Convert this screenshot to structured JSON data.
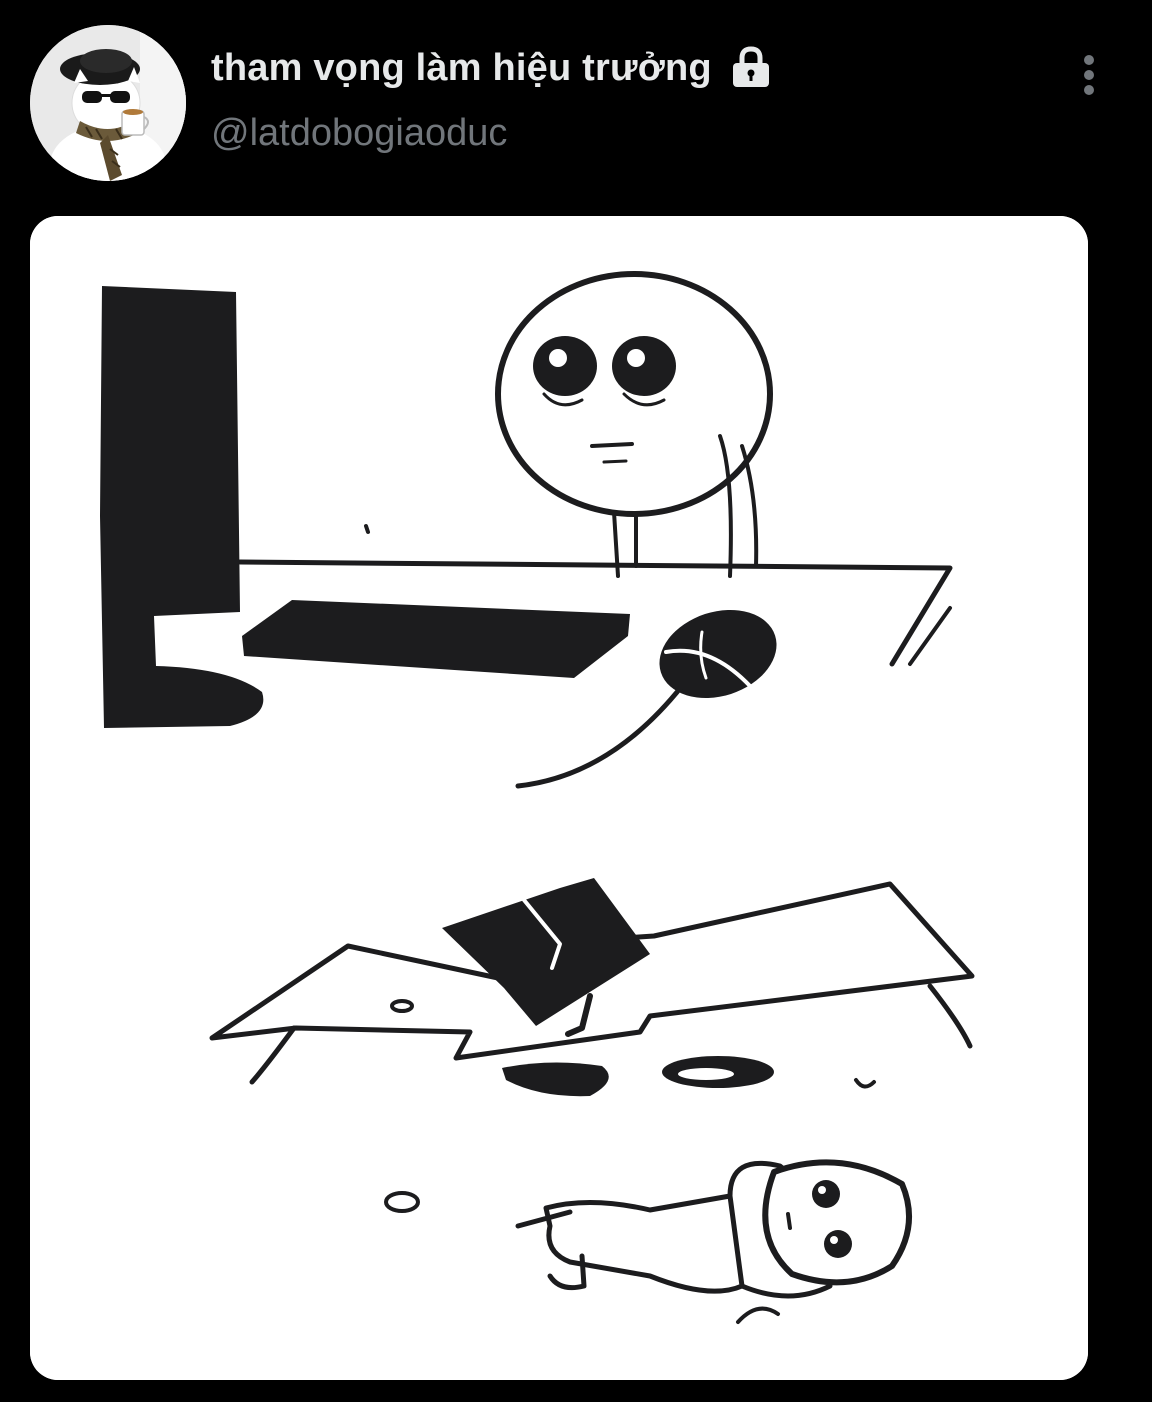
{
  "post": {
    "display_name": "tham vọng làm hiệu trưởng",
    "handle": "@latdobogiaoduc",
    "protected_icon": "lock-icon",
    "more_icon": "more-options-icon",
    "avatar_icon": "profile-avatar"
  },
  "media": {
    "type": "image",
    "description_icon": "stick-figure-comic"
  },
  "colors": {
    "background": "#000000",
    "display_name": "#e7e9ea",
    "handle": "#71767b",
    "more_icon": "#71767b",
    "media_background": "#ffffff",
    "ink": "#1c1c1e"
  }
}
